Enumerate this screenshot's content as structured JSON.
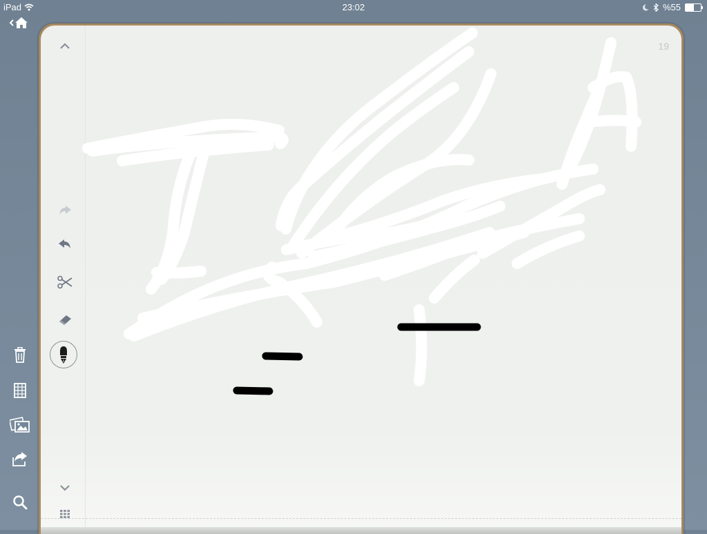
{
  "status_bar": {
    "device": "iPad",
    "time": "23:02",
    "battery_text": "%55",
    "battery_level": 0.55
  },
  "notebook": {
    "page_number": "19"
  },
  "icons": {
    "home": "home-back-icon",
    "scroll_up": "chevron-up-icon",
    "redo": "redo-icon",
    "undo": "undo-icon",
    "cut": "scissors-icon",
    "eraser": "eraser-icon",
    "pen": "fountain-pen-icon",
    "scroll_down": "chevron-down-icon",
    "page_grid": "grid-icon",
    "trash": "trash-icon",
    "paper": "paper-template-icon",
    "photos": "photos-icon",
    "share": "share-icon",
    "search": "search-icon"
  },
  "colors": {
    "background": "#74879a",
    "paper": "#eff1ee",
    "ink_white": "#ffffff",
    "ink_black": "#000000",
    "notebook_edge": "#a8895f"
  }
}
